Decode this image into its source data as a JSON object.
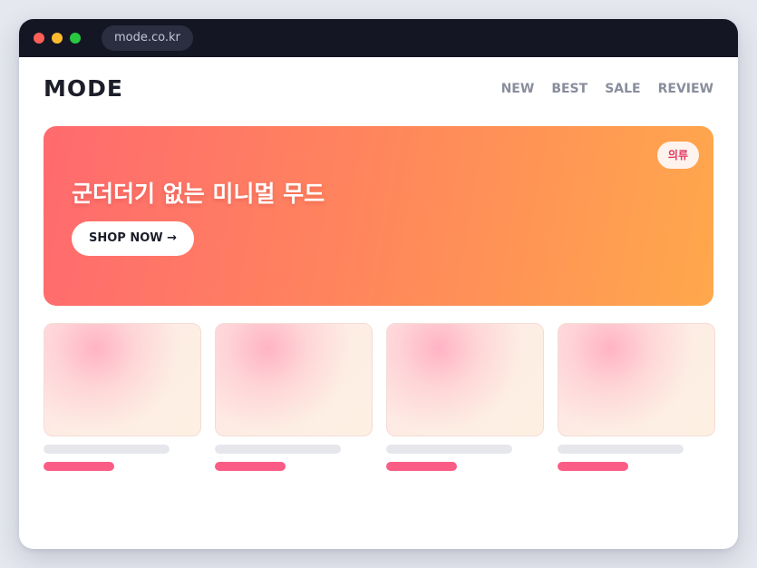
{
  "browser": {
    "url": "mode.co.kr"
  },
  "header": {
    "logo": "MODE",
    "nav": [
      "NEW",
      "BEST",
      "SALE",
      "REVIEW"
    ]
  },
  "hero": {
    "tag": "의류",
    "title": "군더더기 없는 미니멀 무드",
    "cta_label": "SHOP NOW →"
  },
  "products": {
    "count": 4,
    "price_accent_color": "#fa5c85"
  },
  "colors": {
    "titlebar": "#141624",
    "hero_gradient_start": "#ff6a6e",
    "hero_gradient_end": "#ffa84c",
    "tag_text": "#e2365e"
  }
}
